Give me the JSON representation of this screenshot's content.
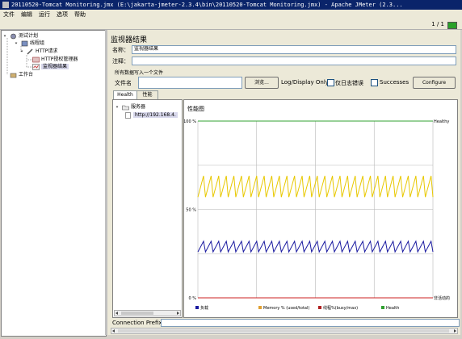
{
  "window": {
    "title": "20110520-Tomcat Monitoring.jmx (E:\\jakarta-jmeter-2.3.4\\bin\\20110520-Tomcat Monitoring.jmx) - Apache JMeter (2.3..."
  },
  "menu": [
    "文件",
    "编辑",
    "运行",
    "选项",
    "帮助"
  ],
  "status_counter": "1 / 1",
  "tree": {
    "items": [
      {
        "label": "测试计划"
      },
      {
        "label": "线程组"
      },
      {
        "label": "HTTP请求"
      },
      {
        "label": "HTTP授权管理器"
      },
      {
        "label": "监视器结果"
      },
      {
        "label": "工作台"
      }
    ]
  },
  "panel": {
    "title": "监视器结果",
    "name_label": "名称：",
    "name_value": "监视器结果",
    "comment_label": "注释：",
    "comment_value": "",
    "file_section_label": "所有数据写入一个文件",
    "file_label": "文件名",
    "file_value": "",
    "browse_button": "浏览...",
    "log_display_label": "Log/Display Only:",
    "errors_only_label": "仅日志错误",
    "successes_label": "Successes",
    "configure_button": "Configure",
    "connection_prefix_label": "Connection Prefix"
  },
  "tabs": [
    {
      "label": "Health",
      "active": true
    },
    {
      "label": "性能",
      "active": false
    }
  ],
  "server_tree": {
    "root": "服务器",
    "child": "http://192.168.4."
  },
  "chart_data": {
    "type": "line",
    "title": "性能图",
    "y_ticks": [
      "100 %",
      "50 %",
      "0 %"
    ],
    "right_labels": {
      "top": "Healthy",
      "bottom": "非活动的"
    },
    "ylim": [
      0,
      100
    ],
    "legend": [
      {
        "name": "负载",
        "color": "#1a1aa0"
      },
      {
        "name": "Memory % (used/total)",
        "color": "#e0a030"
      },
      {
        "name": "线程%(busy/max)",
        "color": "#b02020"
      },
      {
        "name": "Health",
        "color": "#30a030"
      }
    ],
    "series": [
      {
        "name": "Health",
        "color": "#30a030",
        "level": 100,
        "amplitude": 0
      },
      {
        "name": "Memory % (used/total)",
        "color": "#e8c800",
        "level": 63,
        "amplitude": 6
      },
      {
        "name": "负载",
        "color": "#1a1aa0",
        "level": 29,
        "amplitude": 3
      },
      {
        "name": "线程%(busy/max)",
        "color": "#cc2020",
        "level": 0,
        "amplitude": 0
      }
    ],
    "sawtooth_cycles": 31
  }
}
